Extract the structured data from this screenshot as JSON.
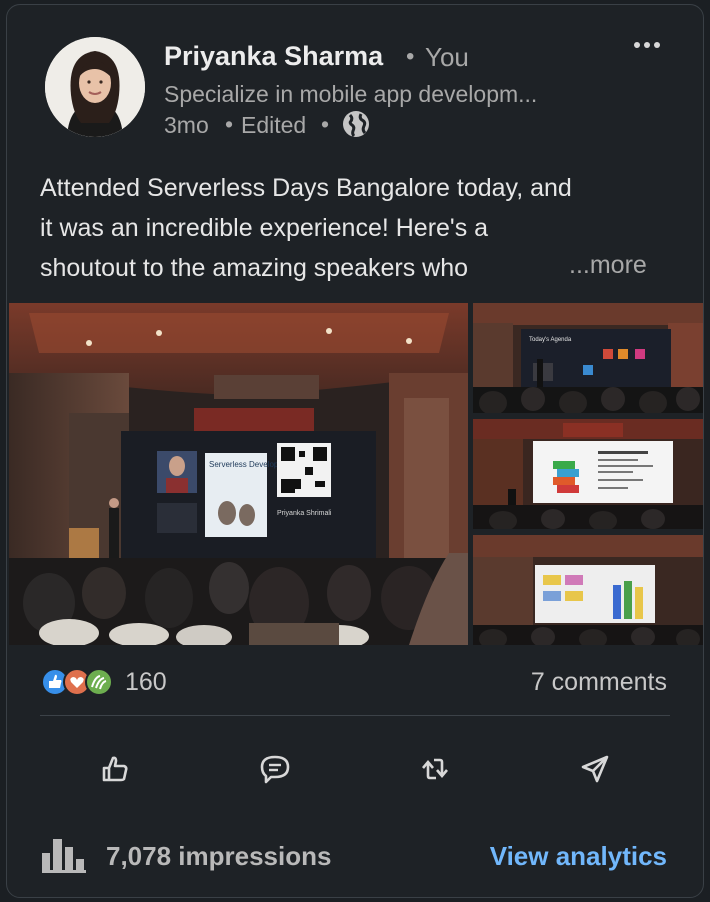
{
  "author": {
    "name": "Priyanka Sharma",
    "relation": "You",
    "headline": "Specialize in mobile app developm...",
    "time": "3mo",
    "edited": "Edited"
  },
  "post": {
    "lines": [
      "Attended Serverless Days Bangalore today, and",
      "it was an incredible experience! Here's a",
      "shoutout to the amazing speakers who"
    ],
    "more_label": "...more"
  },
  "images": {
    "slide_title": "Serverless Development on AWS",
    "slide_footer": "Priyanka Shrimali",
    "side_slide_title": "Today's Agenda"
  },
  "social": {
    "reaction_count": "160",
    "comments_label": "7 comments"
  },
  "footer": {
    "impressions_label": "7,078 impressions",
    "analytics_label": "View analytics"
  },
  "colors": {
    "background": "#1e2226",
    "link": "#71b7fb",
    "muted": "#a8a8a8"
  }
}
